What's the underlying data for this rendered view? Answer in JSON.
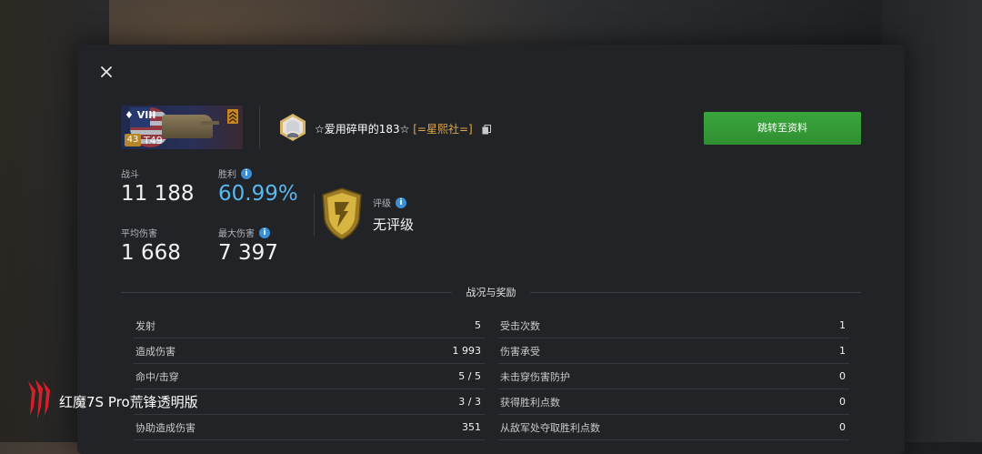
{
  "tank": {
    "tier": "VIII",
    "level": "43",
    "name": "T49"
  },
  "player": {
    "name": "☆爱用碎甲的183☆",
    "clan": "[=星熙社=]"
  },
  "profile_button": "跳转至资料",
  "stats": {
    "battles": {
      "label": "战斗",
      "value": "11 188"
    },
    "win_rate": {
      "label": "胜利",
      "value": "60.99%"
    },
    "avg_damage": {
      "label": "平均伤害",
      "value": "1 668"
    },
    "max_damage": {
      "label": "最大伤害",
      "value": "7 397"
    }
  },
  "rating": {
    "label": "评级",
    "value": "无评级"
  },
  "section_title": "战况与奖励",
  "table_left": [
    {
      "label": "发射",
      "value": "5"
    },
    {
      "label": "造成伤害",
      "value": "1 993"
    },
    {
      "label": "命中/击穿",
      "value": "5 / 5"
    },
    {
      "label": "",
      "value": "3 / 3"
    },
    {
      "label": "协助造成伤害",
      "value": "351"
    }
  ],
  "table_right": [
    {
      "label": "受击次数",
      "value": "1"
    },
    {
      "label": "伤害承受",
      "value": "1"
    },
    {
      "label": "未击穿伤害防护",
      "value": "0"
    },
    {
      "label": "获得胜利点数",
      "value": "0"
    },
    {
      "label": "从敌军处夺取胜利点数",
      "value": "0"
    }
  ],
  "watermark": "红魔7S Pro荒锋透明版",
  "colors": {
    "accent_green": "#3aa63c",
    "win_rate_blue": "#5ab8f0",
    "clan_orange": "#e0a64a",
    "info_blue": "#3b8fd4",
    "modal_bg": "#212326"
  }
}
